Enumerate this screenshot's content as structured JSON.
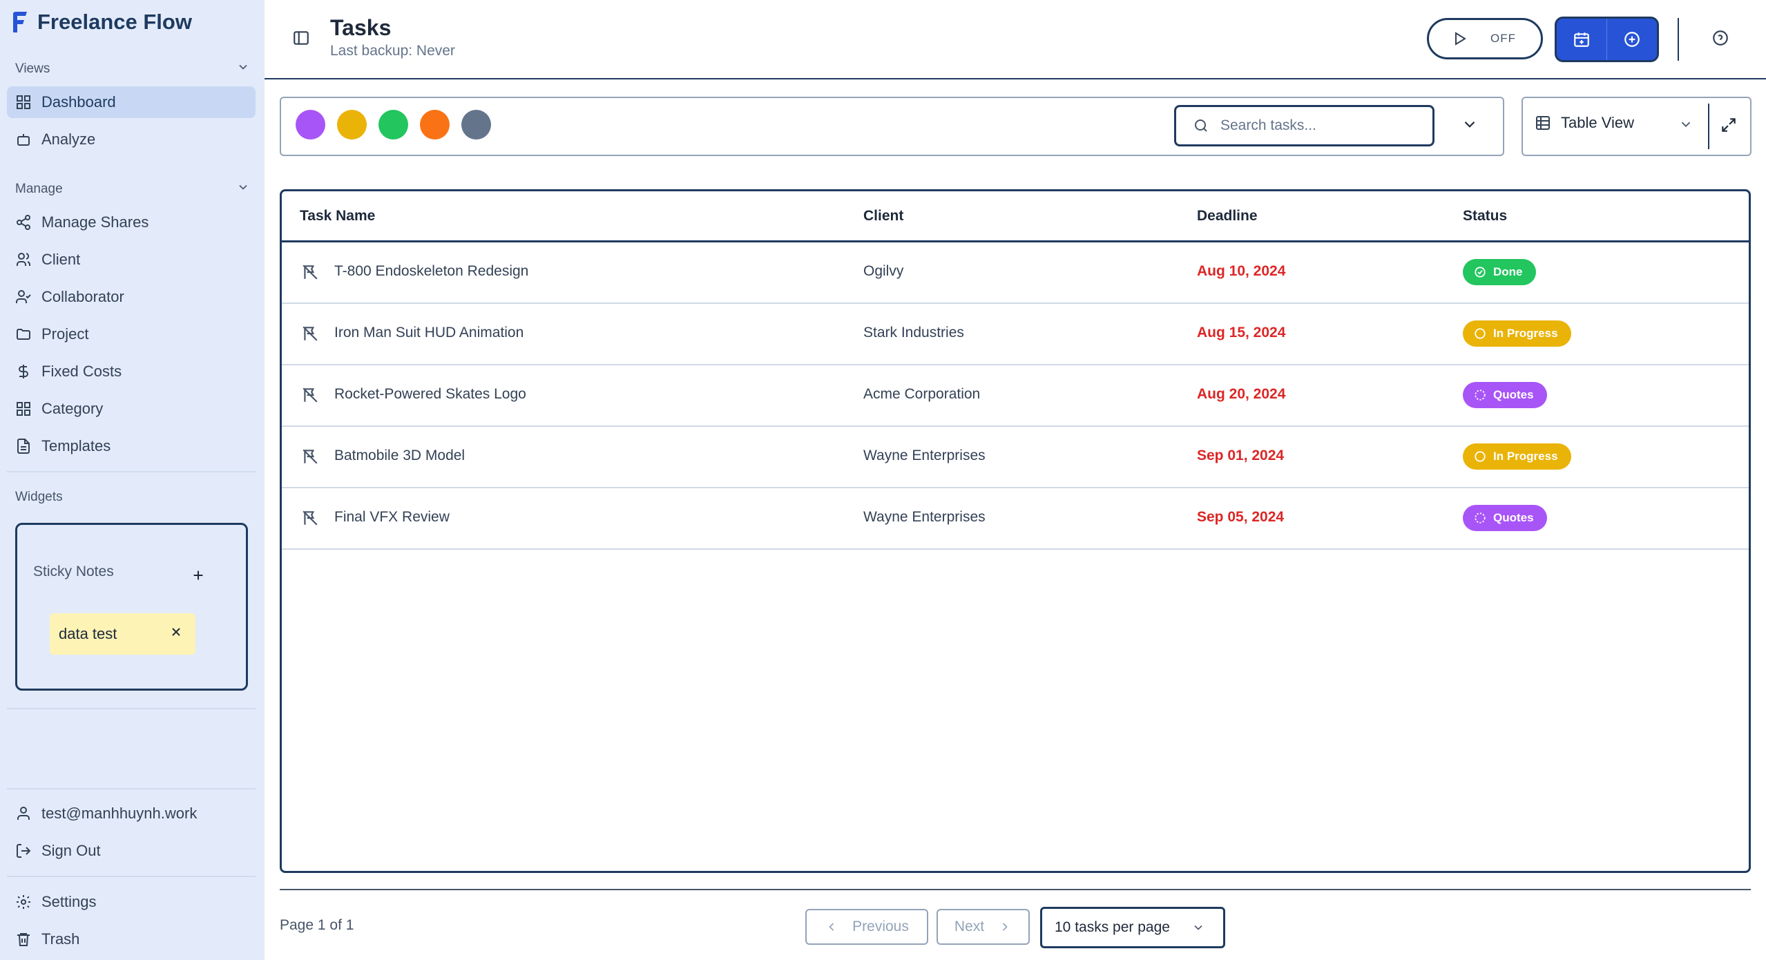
{
  "app": {
    "name": "Freelance Flow"
  },
  "sidebar": {
    "views_label": "Views",
    "views": [
      {
        "label": "Dashboard",
        "icon": "dashboard-icon",
        "active": true
      },
      {
        "label": "Analyze",
        "icon": "analyze-icon"
      }
    ],
    "manage_label": "Manage",
    "manage": [
      {
        "label": "Manage Shares",
        "icon": "share-icon"
      },
      {
        "label": "Client",
        "icon": "users-icon"
      },
      {
        "label": "Collaborator",
        "icon": "user-check-icon"
      },
      {
        "label": "Project",
        "icon": "folder-icon"
      },
      {
        "label": "Fixed Costs",
        "icon": "dollar-icon"
      },
      {
        "label": "Category",
        "icon": "grid-icon"
      },
      {
        "label": "Templates",
        "icon": "file-icon"
      }
    ],
    "widgets_label": "Widgets",
    "sticky_notes": {
      "title": "Sticky Notes",
      "notes": [
        {
          "text": "data test"
        }
      ]
    },
    "user_email": "test@manhhuynh.work",
    "sign_out": "Sign Out",
    "settings": "Settings",
    "trash": "Trash"
  },
  "header": {
    "title": "Tasks",
    "subtitle": "Last backup: Never",
    "timer_state": "OFF"
  },
  "toolbar": {
    "color_filters": [
      "#a855f7",
      "#eab308",
      "#22c55e",
      "#f97316",
      "#64748b"
    ],
    "search_placeholder": "Search tasks...",
    "view_label": "Table View"
  },
  "table": {
    "columns": [
      "Task Name",
      "Client",
      "Deadline",
      "Status"
    ],
    "rows": [
      {
        "task": "T-800 Endoskeleton Redesign",
        "client": "Ogilvy",
        "deadline": "Aug 10, 2024",
        "status": "Done",
        "status_color": "#22c55e"
      },
      {
        "task": "Iron Man Suit HUD Animation",
        "client": "Stark Industries",
        "deadline": "Aug 15, 2024",
        "status": "In Progress",
        "status_color": "#eab308"
      },
      {
        "task": "Rocket-Powered Skates Logo",
        "client": "Acme Corporation",
        "deadline": "Aug 20, 2024",
        "status": "Quotes",
        "status_color": "#a855f7"
      },
      {
        "task": "Batmobile 3D Model",
        "client": "Wayne Enterprises",
        "deadline": "Sep 01, 2024",
        "status": "In Progress",
        "status_color": "#eab308"
      },
      {
        "task": "Final VFX Review",
        "client": "Wayne Enterprises",
        "deadline": "Sep 05, 2024",
        "status": "Quotes",
        "status_color": "#a855f7"
      }
    ]
  },
  "pagination": {
    "page_info": "Page 1 of 1",
    "previous": "Previous",
    "next": "Next",
    "per_page": "10 tasks per page"
  }
}
